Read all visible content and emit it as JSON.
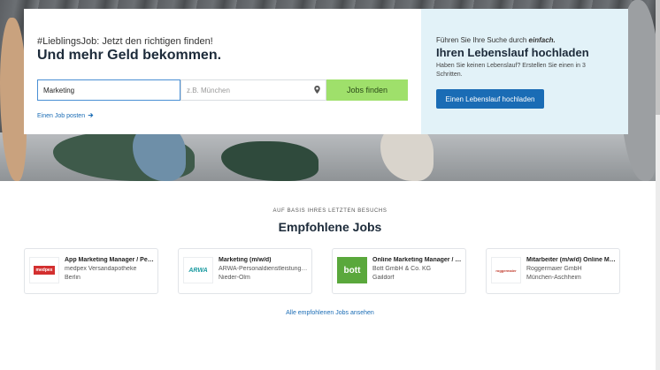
{
  "search": {
    "tagline": "#LieblingsJob: Jetzt den richtigen finden!",
    "headline": "Und mehr Geld bekommen.",
    "job_value": "Marketing",
    "location_placeholder": "z.B. München",
    "find_button": "Jobs finden",
    "post_job_link": "Einen Job posten"
  },
  "cv": {
    "line1_prefix": "Führen Sie Ihre Suche durch",
    "line1_emphasis": "einfach.",
    "title": "Ihren Lebenslauf hochladen",
    "text": "Haben Sie keinen Lebenslauf? Erstellen Sie einen in 3 Schritten.",
    "button": "Einen Lebenslauf hochladen"
  },
  "recommended": {
    "kicker": "AUF BASIS IHRES LETZTEN BESUCHS",
    "title": "Empfohlene Jobs",
    "all_link": "Alle empfohlenen Jobs ansehen",
    "jobs": [
      {
        "title": "App Marketing Manager / Perf…",
        "company": "medpex Versandapotheke",
        "location": "Berlin",
        "logo_text": "medpex",
        "logo_color": "#d32f2f"
      },
      {
        "title": "Marketing (m/w/d)",
        "company": "ARWA-Personaldienstleistung…",
        "location": "Nieder-Olm",
        "logo_text": "ARWA",
        "logo_color": "#1a9aa0"
      },
      {
        "title": "Online Marketing Manager / D…",
        "company": "Bott GmbH & Co. KG",
        "location": "Gaildorf",
        "logo_text": "bott",
        "logo_color": "#5aa83c"
      },
      {
        "title": "Mitarbeiter (m/w/d) Online M…",
        "company": "Roggermaier GmbH",
        "location": "München-Aschheim",
        "logo_text": "roggermaier",
        "logo_color": "#c0392b"
      }
    ]
  },
  "colors": {
    "accent_blue": "#1a6cb5",
    "find_green": "#9fe06b",
    "cv_panel": "#e2f2f8"
  }
}
